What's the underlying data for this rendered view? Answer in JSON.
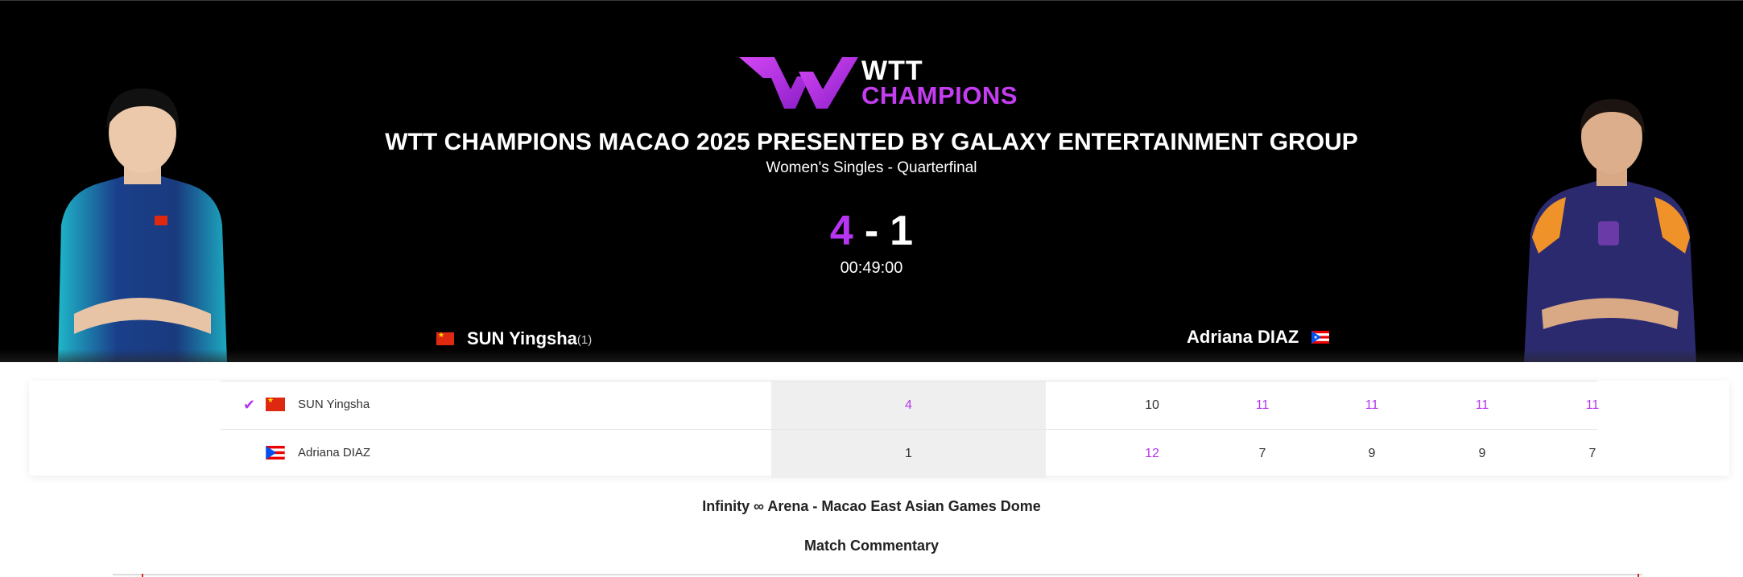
{
  "brand": {
    "logo_line1": "WTT",
    "logo_line2": "CHAMPIONS",
    "accent_color": "#b535f0"
  },
  "event": {
    "title": "WTT CHAMPIONS MACAO 2025 PRESENTED BY GALAXY ENTERTAINMENT GROUP",
    "subtitle": "Women's Singles - Quarterfinal"
  },
  "match": {
    "score_player1": "4",
    "score_separator": "-",
    "score_player2": "1",
    "duration": "00:49:00"
  },
  "players": {
    "left": {
      "name": "SUN Yingsha",
      "seed": "(1)",
      "flag_icon": "china-flag-icon"
    },
    "right": {
      "name": "Adriana DIAZ",
      "flag_icon": "puerto-rico-flag-icon"
    }
  },
  "scoreboard": {
    "rows": [
      {
        "name": "SUN Yingsha",
        "winner": true,
        "games": "4",
        "sets": [
          "10",
          "11",
          "11",
          "11",
          "11"
        ]
      },
      {
        "name": "Adriana DIAZ",
        "winner": false,
        "games": "1",
        "sets": [
          "12",
          "7",
          "9",
          "9",
          "7"
        ]
      }
    ]
  },
  "venue": "Infinity ∞ Arena - Macao East Asian Games Dome",
  "commentary_heading": "Match Commentary"
}
